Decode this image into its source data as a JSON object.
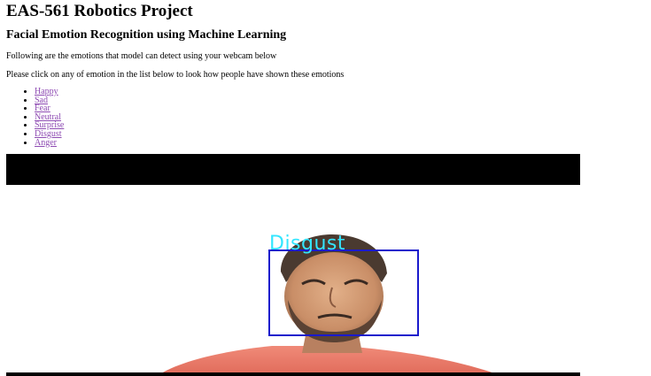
{
  "page": {
    "title": "EAS-561 Robotics Project",
    "subtitle": "Facial Emotion Recognition using Machine Learning",
    "intro": "Following are the emotions that model can detect using your webcam below",
    "instruction": "Please click on any of emotion in the list below to look how people have shown these emotions"
  },
  "emotions": [
    "Happy",
    "Sad",
    "Fear",
    "Neutral",
    "Surprise",
    "Disgust",
    "Anger"
  ],
  "webcam": {
    "detected_label": "Disgust",
    "label_color": "#33e6ff",
    "box_color": "#1a1acc"
  }
}
